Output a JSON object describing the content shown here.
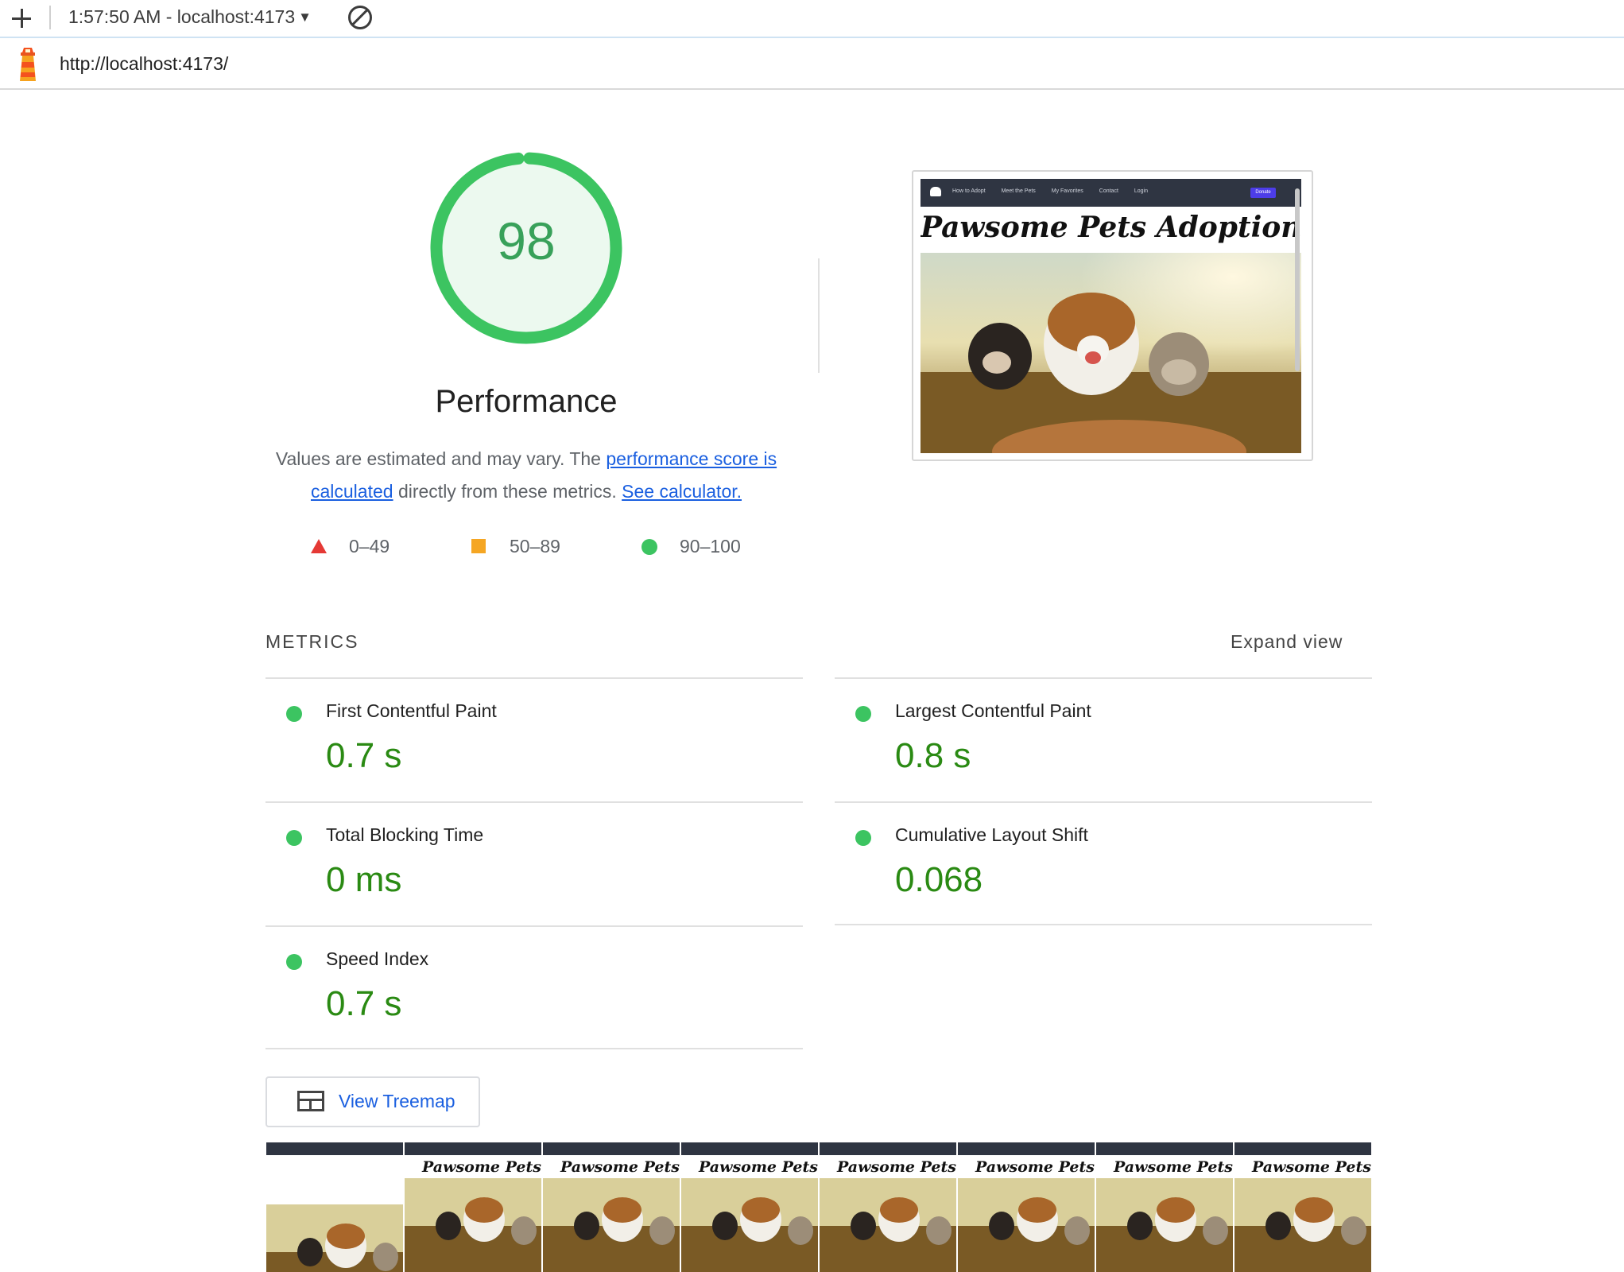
{
  "toolbar": {
    "session_label": "1:57:50 AM - localhost:4173",
    "url": "http://localhost:4173/"
  },
  "performance": {
    "score": "98",
    "title": "Performance",
    "desc_before": "Values are estimated and may vary. The ",
    "score_link": "performance score is calculated",
    "desc_middle": " directly from these metrics. ",
    "calc_link": "See calculator.",
    "legend": [
      {
        "range": "0–49",
        "shape": "triangle",
        "color": "#e53935"
      },
      {
        "range": "50–89",
        "shape": "square",
        "color": "#f5a623"
      },
      {
        "range": "90–100",
        "shape": "circle",
        "color": "#3cc461"
      }
    ]
  },
  "preview": {
    "nav_links": [
      "How to Adopt",
      "Meet the Pets",
      "My Favorites",
      "Contact",
      "Login"
    ],
    "donate_label": "Donate",
    "site_title": "Pawsome Pets Adoption"
  },
  "metrics": {
    "section_label": "METRICS",
    "expand_label": "Expand view",
    "items": [
      {
        "name": "First Contentful Paint",
        "value": "0.7 s"
      },
      {
        "name": "Largest Contentful Paint",
        "value": "0.8 s"
      },
      {
        "name": "Total Blocking Time",
        "value": "0 ms"
      },
      {
        "name": "Cumulative Layout Shift",
        "value": "0.068"
      },
      {
        "name": "Speed Index",
        "value": "0.7 s"
      }
    ]
  },
  "treemap": {
    "label": "View Treemap"
  },
  "filmstrip": {
    "frame_title": "Pawsome Pets Ado",
    "frame_count": 8
  },
  "colors": {
    "pass": "#3cc461",
    "pass_text": "#2a8a13",
    "link": "#1a5fe0",
    "nav_dark": "#2f3542"
  }
}
